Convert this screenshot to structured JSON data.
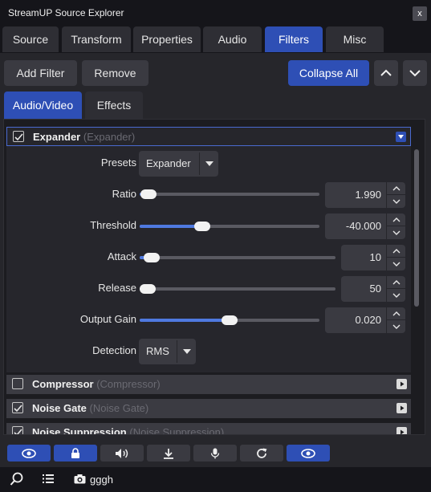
{
  "window": {
    "title": "StreamUP Source Explorer",
    "close_glyph": "x"
  },
  "tabs": [
    {
      "label": "Source",
      "active": false
    },
    {
      "label": "Transform",
      "active": false
    },
    {
      "label": "Properties",
      "active": false
    },
    {
      "label": "Audio",
      "active": false
    },
    {
      "label": "Filters",
      "active": true
    },
    {
      "label": "Misc",
      "active": false
    }
  ],
  "toolbar": {
    "add_filter": "Add Filter",
    "remove": "Remove",
    "collapse_all": "Collapse All",
    "move_up_icon": "chevron-up-icon",
    "move_down_icon": "chevron-down-icon"
  },
  "subtabs": [
    {
      "label": "Audio/Video",
      "active": true
    },
    {
      "label": "Effects",
      "active": false
    }
  ],
  "filters": [
    {
      "name": "Expander",
      "type": "(Expander)",
      "enabled": true,
      "expanded": true
    },
    {
      "name": "Compressor",
      "type": "(Compressor)",
      "enabled": false,
      "expanded": false
    },
    {
      "name": "Noise Gate",
      "type": "(Noise Gate)",
      "enabled": true,
      "expanded": false
    },
    {
      "name": "Noise Suppression",
      "type": "(Noise Suppression)",
      "enabled": true,
      "expanded": false
    }
  ],
  "expander": {
    "presets": {
      "label": "Presets",
      "value": "Expander"
    },
    "ratio": {
      "label": "Ratio",
      "value": "1.990",
      "slider_fraction": 0.05
    },
    "threshold": {
      "label": "Threshold",
      "value": "-40.000",
      "slider_fraction": 0.35
    },
    "attack": {
      "label": "Attack",
      "value": "10",
      "slider_fraction": 0.06
    },
    "release": {
      "label": "Release",
      "value": "50",
      "slider_fraction": 0.03
    },
    "output_gain": {
      "label": "Output Gain",
      "value": "0.020",
      "slider_fraction": 0.5
    },
    "detection": {
      "label": "Detection",
      "value": "RMS"
    }
  },
  "bottom_toolbar": [
    {
      "icon": "eye-icon",
      "active": true
    },
    {
      "icon": "lock-icon",
      "active": true
    },
    {
      "icon": "speaker-icon",
      "active": false
    },
    {
      "icon": "download-icon",
      "active": false
    },
    {
      "icon": "microphone-icon",
      "active": false
    },
    {
      "icon": "refresh-icon",
      "active": false
    },
    {
      "icon": "eye-icon",
      "active": true
    }
  ],
  "status": {
    "source_name": "gggh",
    "search_icon": "search-icon",
    "list_icon": "list-icon",
    "camera_icon": "camera-icon"
  },
  "colors": {
    "accent": "#2e4fb5",
    "slider_fill": "#4f79e0",
    "background": "#26262b",
    "header_bg": "#15151a"
  }
}
